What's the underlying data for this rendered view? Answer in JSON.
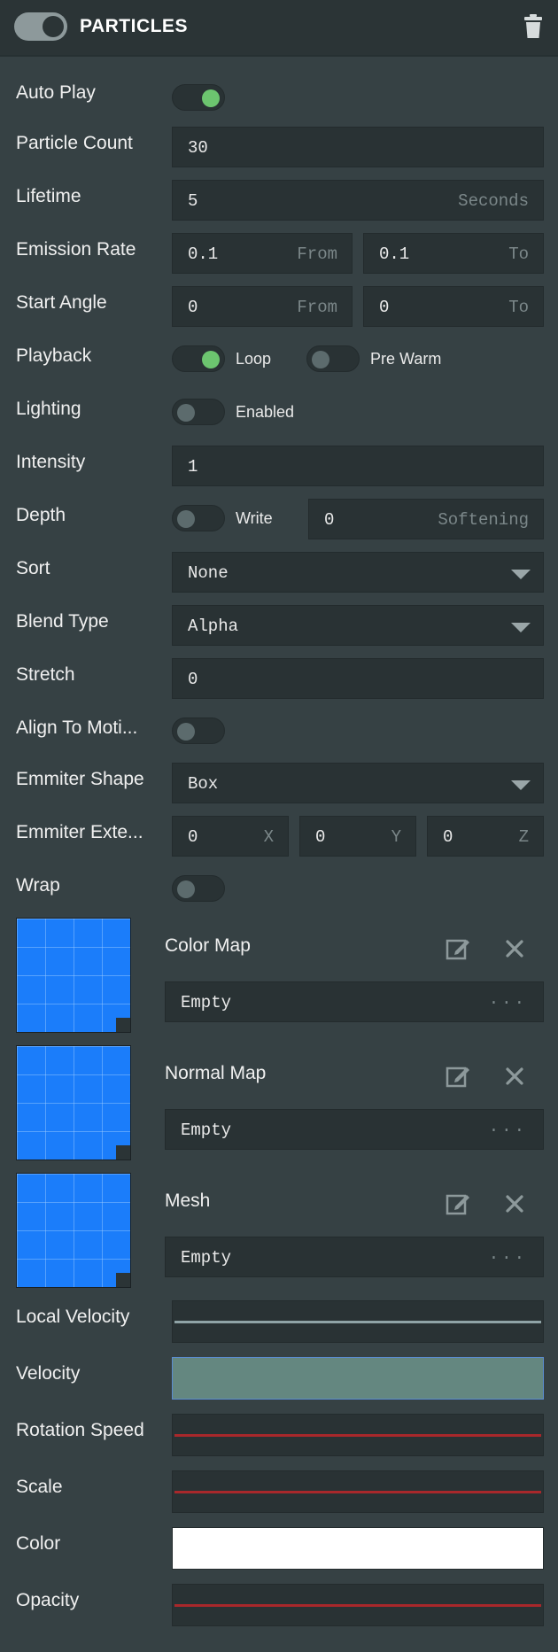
{
  "header": {
    "title": "PARTICLES",
    "enabled": true
  },
  "rows": {
    "auto_play": {
      "label": "Auto Play",
      "on": true
    },
    "particle_count": {
      "label": "Particle Count",
      "value": "30"
    },
    "lifetime": {
      "label": "Lifetime",
      "value": "5",
      "suffix": "Seconds"
    },
    "emission_rate": {
      "label": "Emission Rate",
      "from": "0.1",
      "from_label": "From",
      "to": "0.1",
      "to_label": "To"
    },
    "start_angle": {
      "label": "Start Angle",
      "from": "0",
      "from_label": "From",
      "to": "0",
      "to_label": "To"
    },
    "playback": {
      "label": "Playback",
      "loop_label": "Loop",
      "loop_on": true,
      "prewarm_label": "Pre Warm",
      "prewarm_on": false
    },
    "lighting": {
      "label": "Lighting",
      "enabled_label": "Enabled",
      "on": false
    },
    "intensity": {
      "label": "Intensity",
      "value": "1"
    },
    "depth": {
      "label": "Depth",
      "write_label": "Write",
      "write_on": false,
      "softening": "0",
      "softening_label": "Softening"
    },
    "sort": {
      "label": "Sort",
      "value": "None"
    },
    "blend_type": {
      "label": "Blend Type",
      "value": "Alpha"
    },
    "stretch": {
      "label": "Stretch",
      "value": "0"
    },
    "align_to_motion": {
      "label": "Align To Moti...",
      "on": false
    },
    "emitter_shape": {
      "label": "Emmiter Shape",
      "value": "Box"
    },
    "emitter_extents": {
      "label": "Emmiter Exte...",
      "x": "0",
      "x_label": "X",
      "y": "0",
      "y_label": "Y",
      "z": "0",
      "z_label": "Z"
    },
    "wrap": {
      "label": "Wrap",
      "on": false
    }
  },
  "assets": [
    {
      "title": "Color Map",
      "value": "Empty",
      "more": "..."
    },
    {
      "title": "Normal Map",
      "value": "Empty",
      "more": "..."
    },
    {
      "title": "Mesh",
      "value": "Empty",
      "more": "..."
    }
  ],
  "curves": {
    "local_velocity": {
      "label": "Local Velocity",
      "line_color": "#8fa3a6"
    },
    "velocity": {
      "label": "Velocity",
      "fill_color": "#648780"
    },
    "rotation_speed": {
      "label": "Rotation Speed",
      "line_color": "#a8282b"
    },
    "scale": {
      "label": "Scale",
      "line_color": "#a8282b"
    },
    "color": {
      "label": "Color",
      "fill_color": "#ffffff"
    },
    "opacity": {
      "label": "Opacity",
      "line_color": "#a8282b"
    }
  },
  "icons": {
    "delete": "trash-icon",
    "edit": "edit-icon",
    "remove": "close-icon",
    "dropdown": "chevron-down-icon"
  },
  "colors": {
    "accent_on": "#6cc56f",
    "thumbnail": "#1b7dfa",
    "panel": "#364144",
    "field": "#293234"
  }
}
